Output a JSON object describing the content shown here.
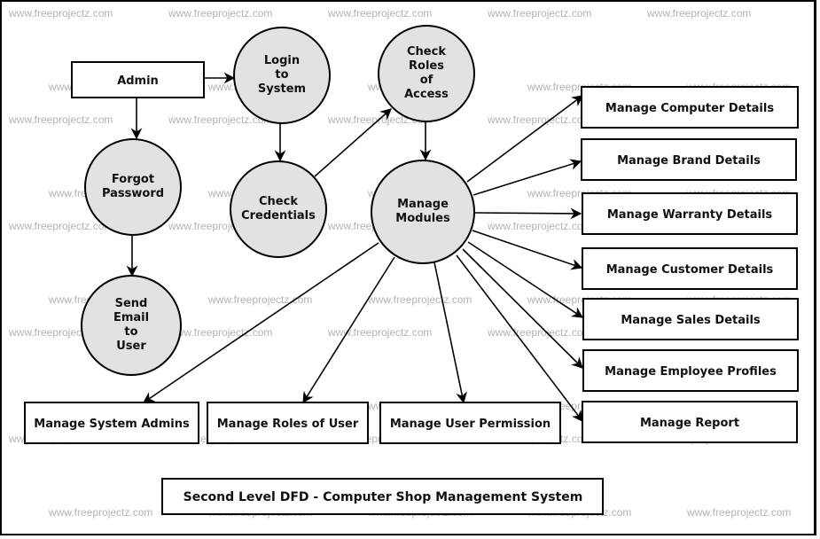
{
  "diagram": {
    "title": "Second Level DFD - Computer Shop Management System",
    "watermark": "www.freeprojectz.com",
    "colors": {
      "process_fill": "#e2e2e2",
      "stroke": "#000000",
      "watermark": "#b4b4b4"
    },
    "entities": [
      {
        "id": "admin",
        "label": "Admin"
      }
    ],
    "processes": [
      {
        "id": "login",
        "lines": [
          "Login",
          "to",
          "System"
        ]
      },
      {
        "id": "check-roles",
        "lines": [
          "Check",
          "Roles",
          "of",
          "Access"
        ]
      },
      {
        "id": "forgot-password",
        "lines": [
          "Forgot",
          "Password"
        ]
      },
      {
        "id": "check-credentials",
        "lines": [
          "Check",
          "Credentials"
        ]
      },
      {
        "id": "manage-modules",
        "lines": [
          "Manage",
          "Modules"
        ]
      },
      {
        "id": "send-email",
        "lines": [
          "Send",
          "Email",
          "to",
          "User"
        ]
      }
    ],
    "modules": [
      {
        "id": "computer",
        "label": "Manage Computer Details"
      },
      {
        "id": "brand",
        "label": "Manage Brand Details"
      },
      {
        "id": "warranty",
        "label": "Manage Warranty Details"
      },
      {
        "id": "customer",
        "label": "Manage Customer Details"
      },
      {
        "id": "sales",
        "label": "Manage Sales Details"
      },
      {
        "id": "employee",
        "label": "Manage Employee Profiles"
      },
      {
        "id": "report",
        "label": "Manage Report"
      },
      {
        "id": "system-admins",
        "label": "Manage System Admins"
      },
      {
        "id": "roles",
        "label": "Manage Roles of User"
      },
      {
        "id": "permission",
        "label": "Manage User Permission"
      }
    ],
    "flows": [
      {
        "from": "admin",
        "to": "login"
      },
      {
        "from": "admin",
        "to": "forgot-password"
      },
      {
        "from": "forgot-password",
        "to": "send-email"
      },
      {
        "from": "login",
        "to": "check-credentials"
      },
      {
        "from": "check-credentials",
        "to": "check-roles"
      },
      {
        "from": "check-roles",
        "to": "manage-modules"
      },
      {
        "from": "manage-modules",
        "to": "computer"
      },
      {
        "from": "manage-modules",
        "to": "brand"
      },
      {
        "from": "manage-modules",
        "to": "warranty"
      },
      {
        "from": "manage-modules",
        "to": "customer"
      },
      {
        "from": "manage-modules",
        "to": "sales"
      },
      {
        "from": "manage-modules",
        "to": "employee"
      },
      {
        "from": "manage-modules",
        "to": "report"
      },
      {
        "from": "manage-modules",
        "to": "system-admins"
      },
      {
        "from": "manage-modules",
        "to": "roles"
      },
      {
        "from": "manage-modules",
        "to": "permission"
      }
    ]
  }
}
